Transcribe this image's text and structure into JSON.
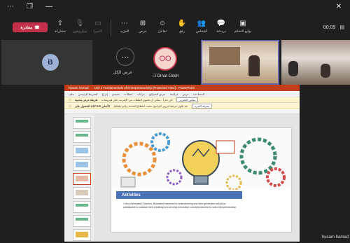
{
  "window": {
    "more": "⋯",
    "restore": "❐",
    "minimize": "—",
    "close": "✕"
  },
  "toolbar": {
    "leave": "مغادرة",
    "share": "مشاركة",
    "mic": "ميكروفون",
    "camera": "كاميرا",
    "more": "المزيد",
    "view": "عرض",
    "react": "تفاعل",
    "raise": "رفع",
    "people": "أشخاص",
    "chat": "دردشة",
    "control": "توابع التحكم"
  },
  "clock": {
    "time": "00:09"
  },
  "participants": {
    "b_initial": "B",
    "more_dots": "⋯",
    "show_all": "عرض الكل",
    "oo_initials": "OO",
    "omar_name": "Omar Odeh",
    "husam_name": "husam hamad"
  },
  "presentation": {
    "window_title": "Unit 2 Fundamentals of Entrepreneurship [Protected View] - PowerPoint",
    "presenter": "husam hamad",
    "tabs": [
      "ملف",
      "الشريط الرئيسي",
      "إدراج",
      "تصميم",
      "انتقالات",
      "حركات",
      "عرض الشرائح",
      "مراجعة",
      "عرض",
      "المساعدة"
    ],
    "banner1": "طريقة عرض محمية",
    "banner1_detail": "كن حذراً - يمكن أن تحتوي الملفات من الإنترنت على فيروسات.",
    "banner1_button": "تمكين التحرير",
    "banner2": "الحصول على OFFICE الأصلي",
    "banner2_detail": "قد تكون عرضة لتزوير البرامج. تجنب انقطاع الخدمة واحم ملفاتك.",
    "banner2_button": "معرفة المزيد",
    "slide_heading": "Activities",
    "slide_bullet": "• Idea Generation Session: Illustrated sessions for brainstorming and idea generation will allow participants to unleash their creativity and develop innovative concepts tailored to rural entrepreneurship."
  }
}
